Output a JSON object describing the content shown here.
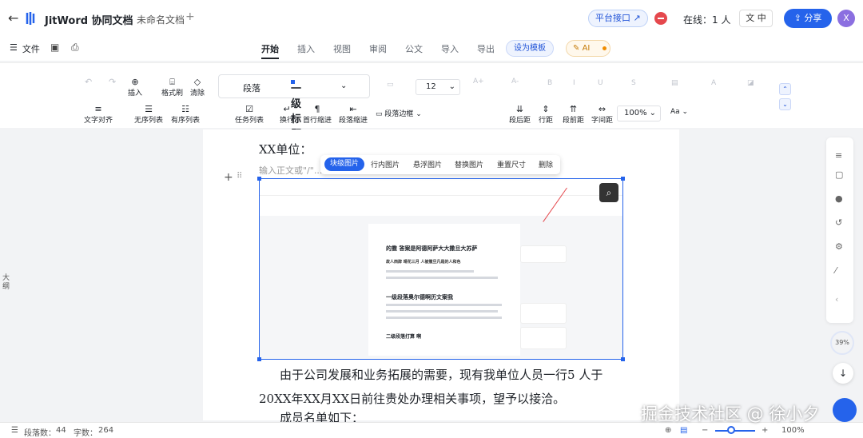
{
  "header": {
    "app_name": "JitWord 协同文档",
    "doc_name": "未命名文档",
    "add_label": "+",
    "api_btn": "平台接口 ↗",
    "online": "在线：1 人",
    "lang": "中",
    "share": "分享",
    "avatar": "X"
  },
  "menu": {
    "file": "文件",
    "tabs": [
      "开始",
      "插入",
      "视图",
      "审阅",
      "公文",
      "导入",
      "导出"
    ],
    "template": "设为模板",
    "ai": "AI"
  },
  "toolbar": {
    "insert": "插入",
    "format_painter": "格式刷",
    "clear": "清除",
    "paragraph": "段落",
    "heading": "一级标题",
    "font_size": "12",
    "align": "文字对齐",
    "unordered": "无序列表",
    "ordered": "有序列表",
    "task": "任务列表",
    "linebreak": "换行",
    "first_indent": "首行缩进",
    "para_indent": "段落缩进",
    "para_border": "段落边框",
    "after_space": "段后距",
    "line_space": "行距",
    "before_space": "段前距",
    "char_space": "字间距",
    "zoom": "100%",
    "aa": "Aa"
  },
  "outline": "大纲",
  "doc": {
    "line1": "XX单位：",
    "placeholder": "输入正文或\"/\"...",
    "body1": "由于公司发展和业务拓展的需要，现有我单位人员一行5 人于20XX年XX月XX日前往贵处办理相关事项，望予以接洽。",
    "body2": "成员名单如下："
  },
  "image_tools": [
    "块级图片",
    "行内图片",
    "悬浮图片",
    "替换图片",
    "重置尺寸",
    "删除"
  ],
  "inner": {
    "title": "的撒 答案是阿德阿萨大大撒旦大苏萨",
    "sub": "故人西辞 晴花三月 人被撒旦凡是的人和色",
    "h1": "一级段落奥尔德啊历文案我",
    "h2": "二级段落打算 啊"
  },
  "side": {
    "pct": "39%"
  },
  "status": {
    "paras": "段落数：",
    "paras_val": "44",
    "words": "字数：",
    "words_val": "264",
    "zoom": "100%"
  },
  "watermark": "掘金技术社区 @ 徐小夕"
}
